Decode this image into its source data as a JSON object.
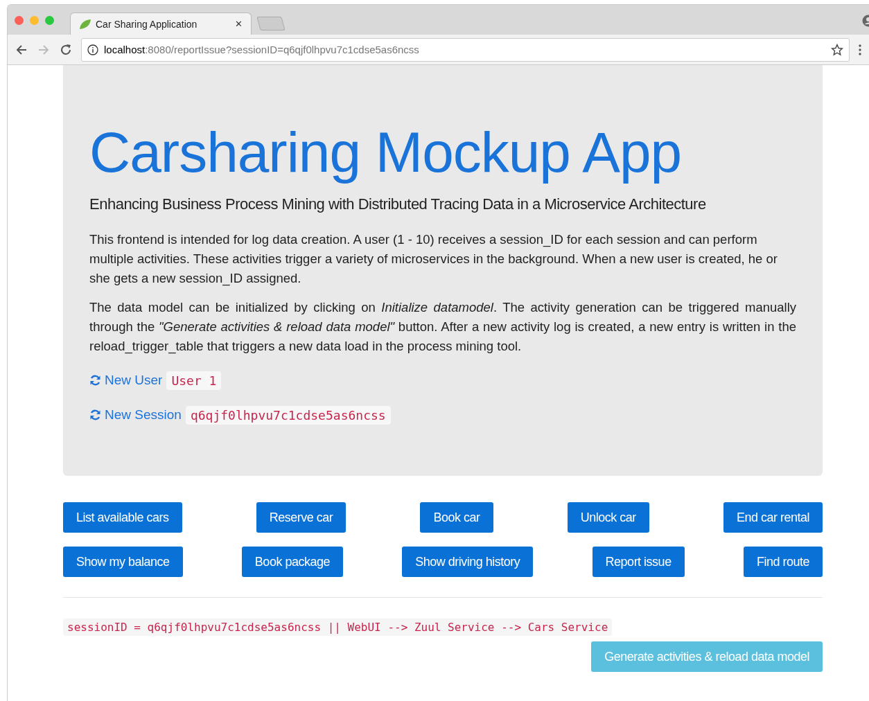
{
  "browser": {
    "tab_title": "Car Sharing Application",
    "tab_close": "✕",
    "url_host": "localhost",
    "url_rest": ":8080/reportIssue?sessionID=q6qjf0lhpvu7c1cdse5as6ncss"
  },
  "jumbotron": {
    "title": "Carsharing Mockup App",
    "subtitle": "Enhancing Business Process Mining with Distributed Tracing Data in a Microservice Architecture",
    "paragraphs": [
      {
        "text": "This frontend is intended for log data creation. A user (1 - 10) receives a session_ID for each session and can perform multiple activities. These activities trigger a variety of microservices in the background. When a new user is created, he or she gets a new session_ID assigned.",
        "justified": false
      },
      {
        "text": "The data model can be initialized by clicking on *Initialize datamodel*. The activity generation can be triggered manually through the *\"Generate activities & reload data model\"* button. After a new activity log is created, a new entry is written in the reload_trigger_table that triggers a new data load in the process mining tool.",
        "justified": true
      }
    ],
    "links": [
      {
        "label": "New User",
        "value": "User 1"
      },
      {
        "label": "New Session",
        "value": "q6qjf0lhpvu7c1cdse5as6ncss"
      }
    ]
  },
  "button_rows": [
    [
      "List available cars",
      "Reserve car",
      "Book car",
      "Unlock car",
      "End car rental"
    ],
    [
      "Show my balance",
      "Book package",
      "Show driving history",
      "Report issue",
      "Find route"
    ]
  ],
  "trace": "sessionID = q6qjf0lhpvu7c1cdse5as6ncss || WebUI --> Zuul Service --> Cars Service",
  "generate_button": "Generate activities & reload data model"
}
